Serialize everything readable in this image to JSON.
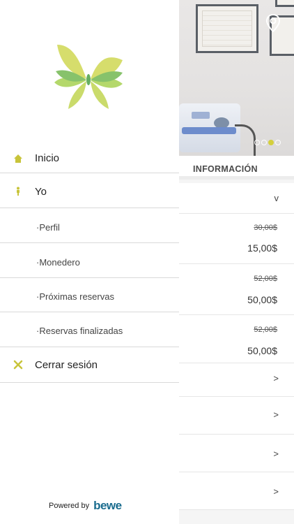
{
  "drawer": {
    "menu": [
      {
        "label": "Inicio",
        "icon": "home-icon"
      },
      {
        "label": "Yo",
        "icon": "person-icon"
      }
    ],
    "sub_items": [
      "·Perfil",
      "·Monedero",
      "·Próximas reservas",
      "·Reservas finalizadas"
    ],
    "logout": {
      "label": "Cerrar sesión",
      "icon": "close-icon"
    },
    "footer": {
      "powered_by": "Powered by",
      "brand": "bewe"
    }
  },
  "background": {
    "section_header": "INFORMACIÓN",
    "carousel": {
      "dots": 4,
      "current": 3
    },
    "prices": [
      {
        "old": "30,00$",
        "new": "15,00$"
      },
      {
        "old": "52,00$",
        "new": "50,00$"
      },
      {
        "old": "52,00$",
        "new": "50,00$"
      }
    ],
    "expand_chevron": "v",
    "chevrons": [
      ">",
      ">",
      ">",
      ">"
    ]
  },
  "colors": {
    "accent": "#c8c43a",
    "brand_blue": "#1a6c8e",
    "logo_green": "#7bbf3a",
    "logo_yellow": "#c9d23b"
  }
}
